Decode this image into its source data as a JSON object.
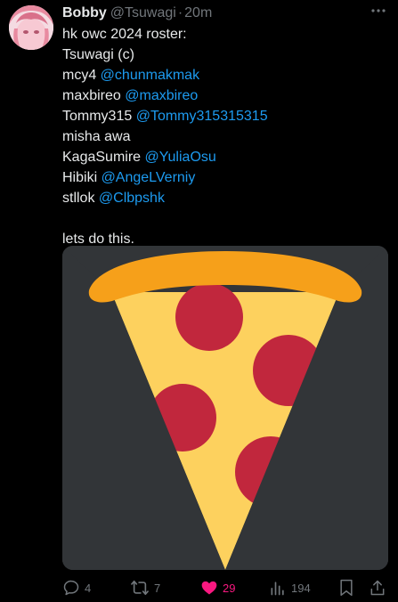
{
  "tweet": {
    "author_name": "Bobby",
    "author_handle": "@Tsuwagi",
    "separator": "·",
    "time": "20m",
    "lines": [
      {
        "text": "hk owc 2024 roster:",
        "mention": ""
      },
      {
        "text": "Tsuwagi (c)",
        "mention": ""
      },
      {
        "text": "mcy4 ",
        "mention": "@chunmakmak"
      },
      {
        "text": "maxbireo ",
        "mention": "@maxbireo"
      },
      {
        "text": "Tommy315 ",
        "mention": "@Tommy315315315"
      },
      {
        "text": "misha awa",
        "mention": ""
      },
      {
        "text": "KagaSumire ",
        "mention": "@YuliaOsu"
      },
      {
        "text": "Hibiki ",
        "mention": "@AngeLVerniy"
      },
      {
        "text": "stllok ",
        "mention": "@Clbpshk"
      }
    ],
    "closing_line": "lets do this.",
    "media": {
      "description_icon": "pizza-slice-icon",
      "background": "#323538"
    }
  },
  "actions": {
    "replies": "4",
    "reposts": "7",
    "likes": "29",
    "views": "194"
  },
  "colors": {
    "background": "#000000",
    "text": "#e7e9ea",
    "muted": "#71767b",
    "mention": "#1d9bf0",
    "like": "#f91880"
  },
  "icons": [
    "avatar",
    "more-icon",
    "reply-icon",
    "repost-icon",
    "like-icon",
    "views-icon",
    "bookmark-icon",
    "share-icon"
  ]
}
